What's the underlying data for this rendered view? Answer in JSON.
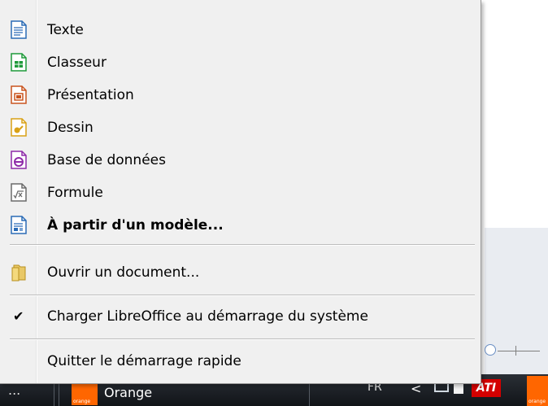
{
  "menu": {
    "items": [
      {
        "label": "Texte",
        "icon": "writer-document-icon",
        "color": "#2a6bb6"
      },
      {
        "label": "Classeur",
        "icon": "calc-spreadsheet-icon",
        "color": "#1f9a3a"
      },
      {
        "label": "Présentation",
        "icon": "impress-presentation-icon",
        "color": "#c9541f"
      },
      {
        "label": "Dessin",
        "icon": "draw-drawing-icon",
        "color": "#d9a116"
      },
      {
        "label": "Base de données",
        "icon": "base-database-icon",
        "color": "#8e2aa8"
      },
      {
        "label": "Formule",
        "icon": "math-formula-icon",
        "color": "#6b6b6b"
      },
      {
        "label": "À partir d'un modèle...",
        "icon": "template-icon",
        "color": "#2a6bb6"
      }
    ],
    "open_document": {
      "label": "Ouvrir un document...",
      "icon": "folder-icon"
    },
    "load_at_startup": {
      "label": "Charger LibreOffice au démarrage du système",
      "checked": true,
      "check_glyph": "✔"
    },
    "quit": {
      "label": "Quitter le démarrage rapide"
    }
  },
  "taskbar": {
    "dots": "...",
    "app_label": "Orange",
    "app_logo_text": "orange",
    "language": "FR",
    "chevron": "<",
    "ati_label": "ATI",
    "orange_tray_text": "orange"
  }
}
